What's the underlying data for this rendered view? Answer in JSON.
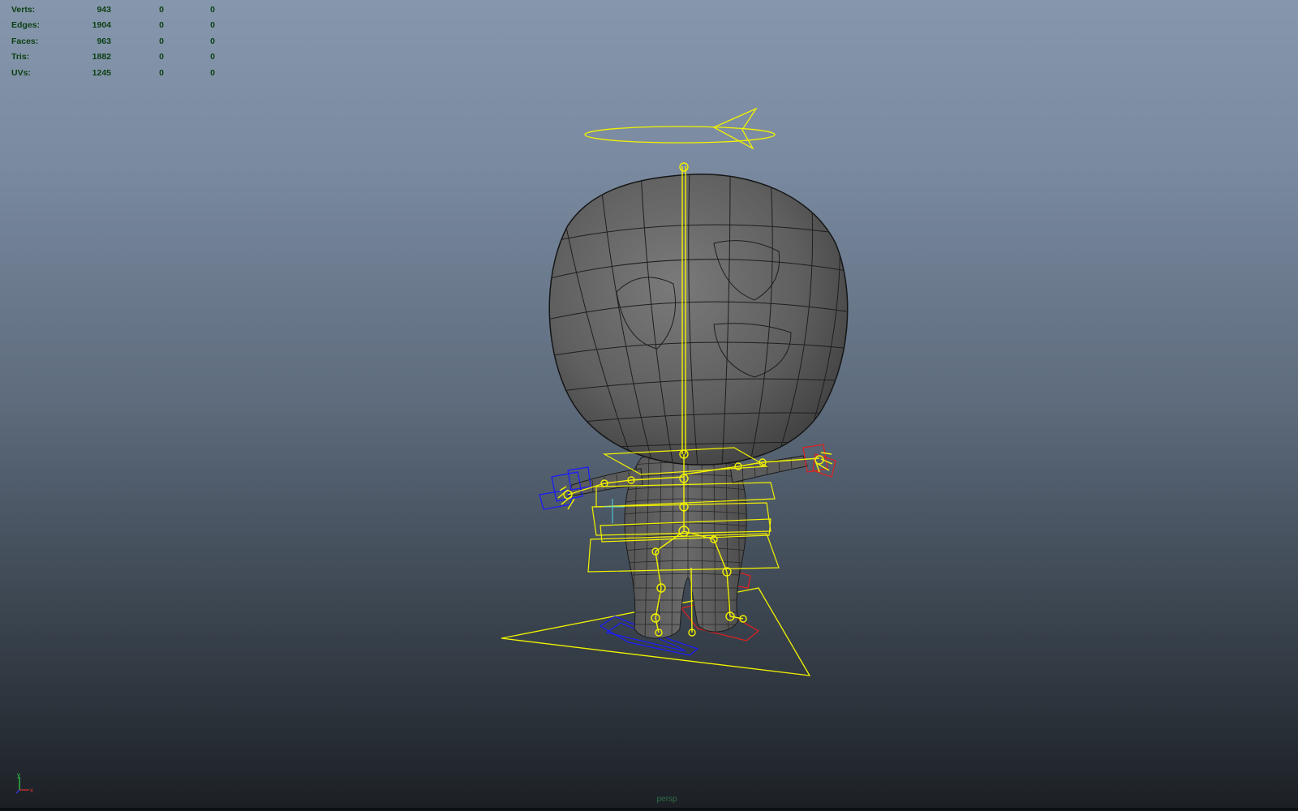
{
  "hud": {
    "rows": [
      {
        "label": "Verts:",
        "values": [
          "943",
          "0",
          "0"
        ]
      },
      {
        "label": "Edges:",
        "values": [
          "1904",
          "0",
          "0"
        ]
      },
      {
        "label": "Faces:",
        "values": [
          "963",
          "0",
          "0"
        ]
      },
      {
        "label": "Tris:",
        "values": [
          "1882",
          "0",
          "0"
        ]
      },
      {
        "label": "UVs:",
        "values": [
          "1245",
          "0",
          "0"
        ]
      }
    ]
  },
  "viewport": {
    "camera_label": "persp",
    "axis_labels": {
      "y": "y",
      "x": "x"
    }
  },
  "colors": {
    "rig_control": "#f2f200",
    "left_control": "#1a1aff",
    "right_control": "#e02020",
    "mesh_fill": "#606060",
    "wire": "#1b1b1b",
    "hud_text": "#0b3d14"
  }
}
